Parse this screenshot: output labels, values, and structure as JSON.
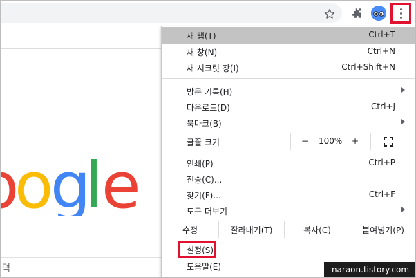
{
  "toolbar": {
    "star_icon": "star-icon",
    "extensions_icon": "puzzle-icon",
    "profile_icon": "profile-avatar",
    "menu_icon": "kebab-menu-icon"
  },
  "page": {
    "logo_text": [
      "o",
      "o",
      "g",
      "l",
      "e"
    ],
    "logo_colors": [
      "#ea4335",
      "#fbbc05",
      "#4285f4",
      "#34a853",
      "#ea4335"
    ],
    "search_partial": "력"
  },
  "menu": {
    "items": [
      {
        "label": "새 탭(T)",
        "shortcut": "Ctrl+T"
      },
      {
        "label": "새 창(N)",
        "shortcut": "Ctrl+N"
      },
      {
        "label": "새 시크릿 창(I)",
        "shortcut": "Ctrl+Shift+N"
      },
      {
        "label": "방문 기록(H)",
        "shortcut": ""
      },
      {
        "label": "다운로드(D)",
        "shortcut": "Ctrl+J"
      },
      {
        "label": "북마크(B)",
        "shortcut": ""
      },
      {
        "label": "인쇄(P)",
        "shortcut": "Ctrl+P"
      },
      {
        "label": "전송(C)...",
        "shortcut": ""
      },
      {
        "label": "찾기(F)...",
        "shortcut": "Ctrl+F"
      },
      {
        "label": "도구 더보기",
        "shortcut": ""
      },
      {
        "label": "설정(S)",
        "shortcut": ""
      },
      {
        "label": "도움말(E)",
        "shortcut": ""
      }
    ],
    "zoom": {
      "label": "글꼴 크기",
      "minus": "−",
      "value": "100%",
      "plus": "+",
      "fullscreen_icon": "fullscreen-icon"
    },
    "edit": {
      "label": "수정",
      "cut": "잘라내기(T)",
      "copy": "복사(C)",
      "paste": "붙여넣기(P)"
    }
  },
  "watermark": "naraon.tistory.com",
  "colors": {
    "highlight": "#c3c3c3",
    "annotation_red": "#e0122f",
    "avatar_blue": "#4a8cf7"
  }
}
